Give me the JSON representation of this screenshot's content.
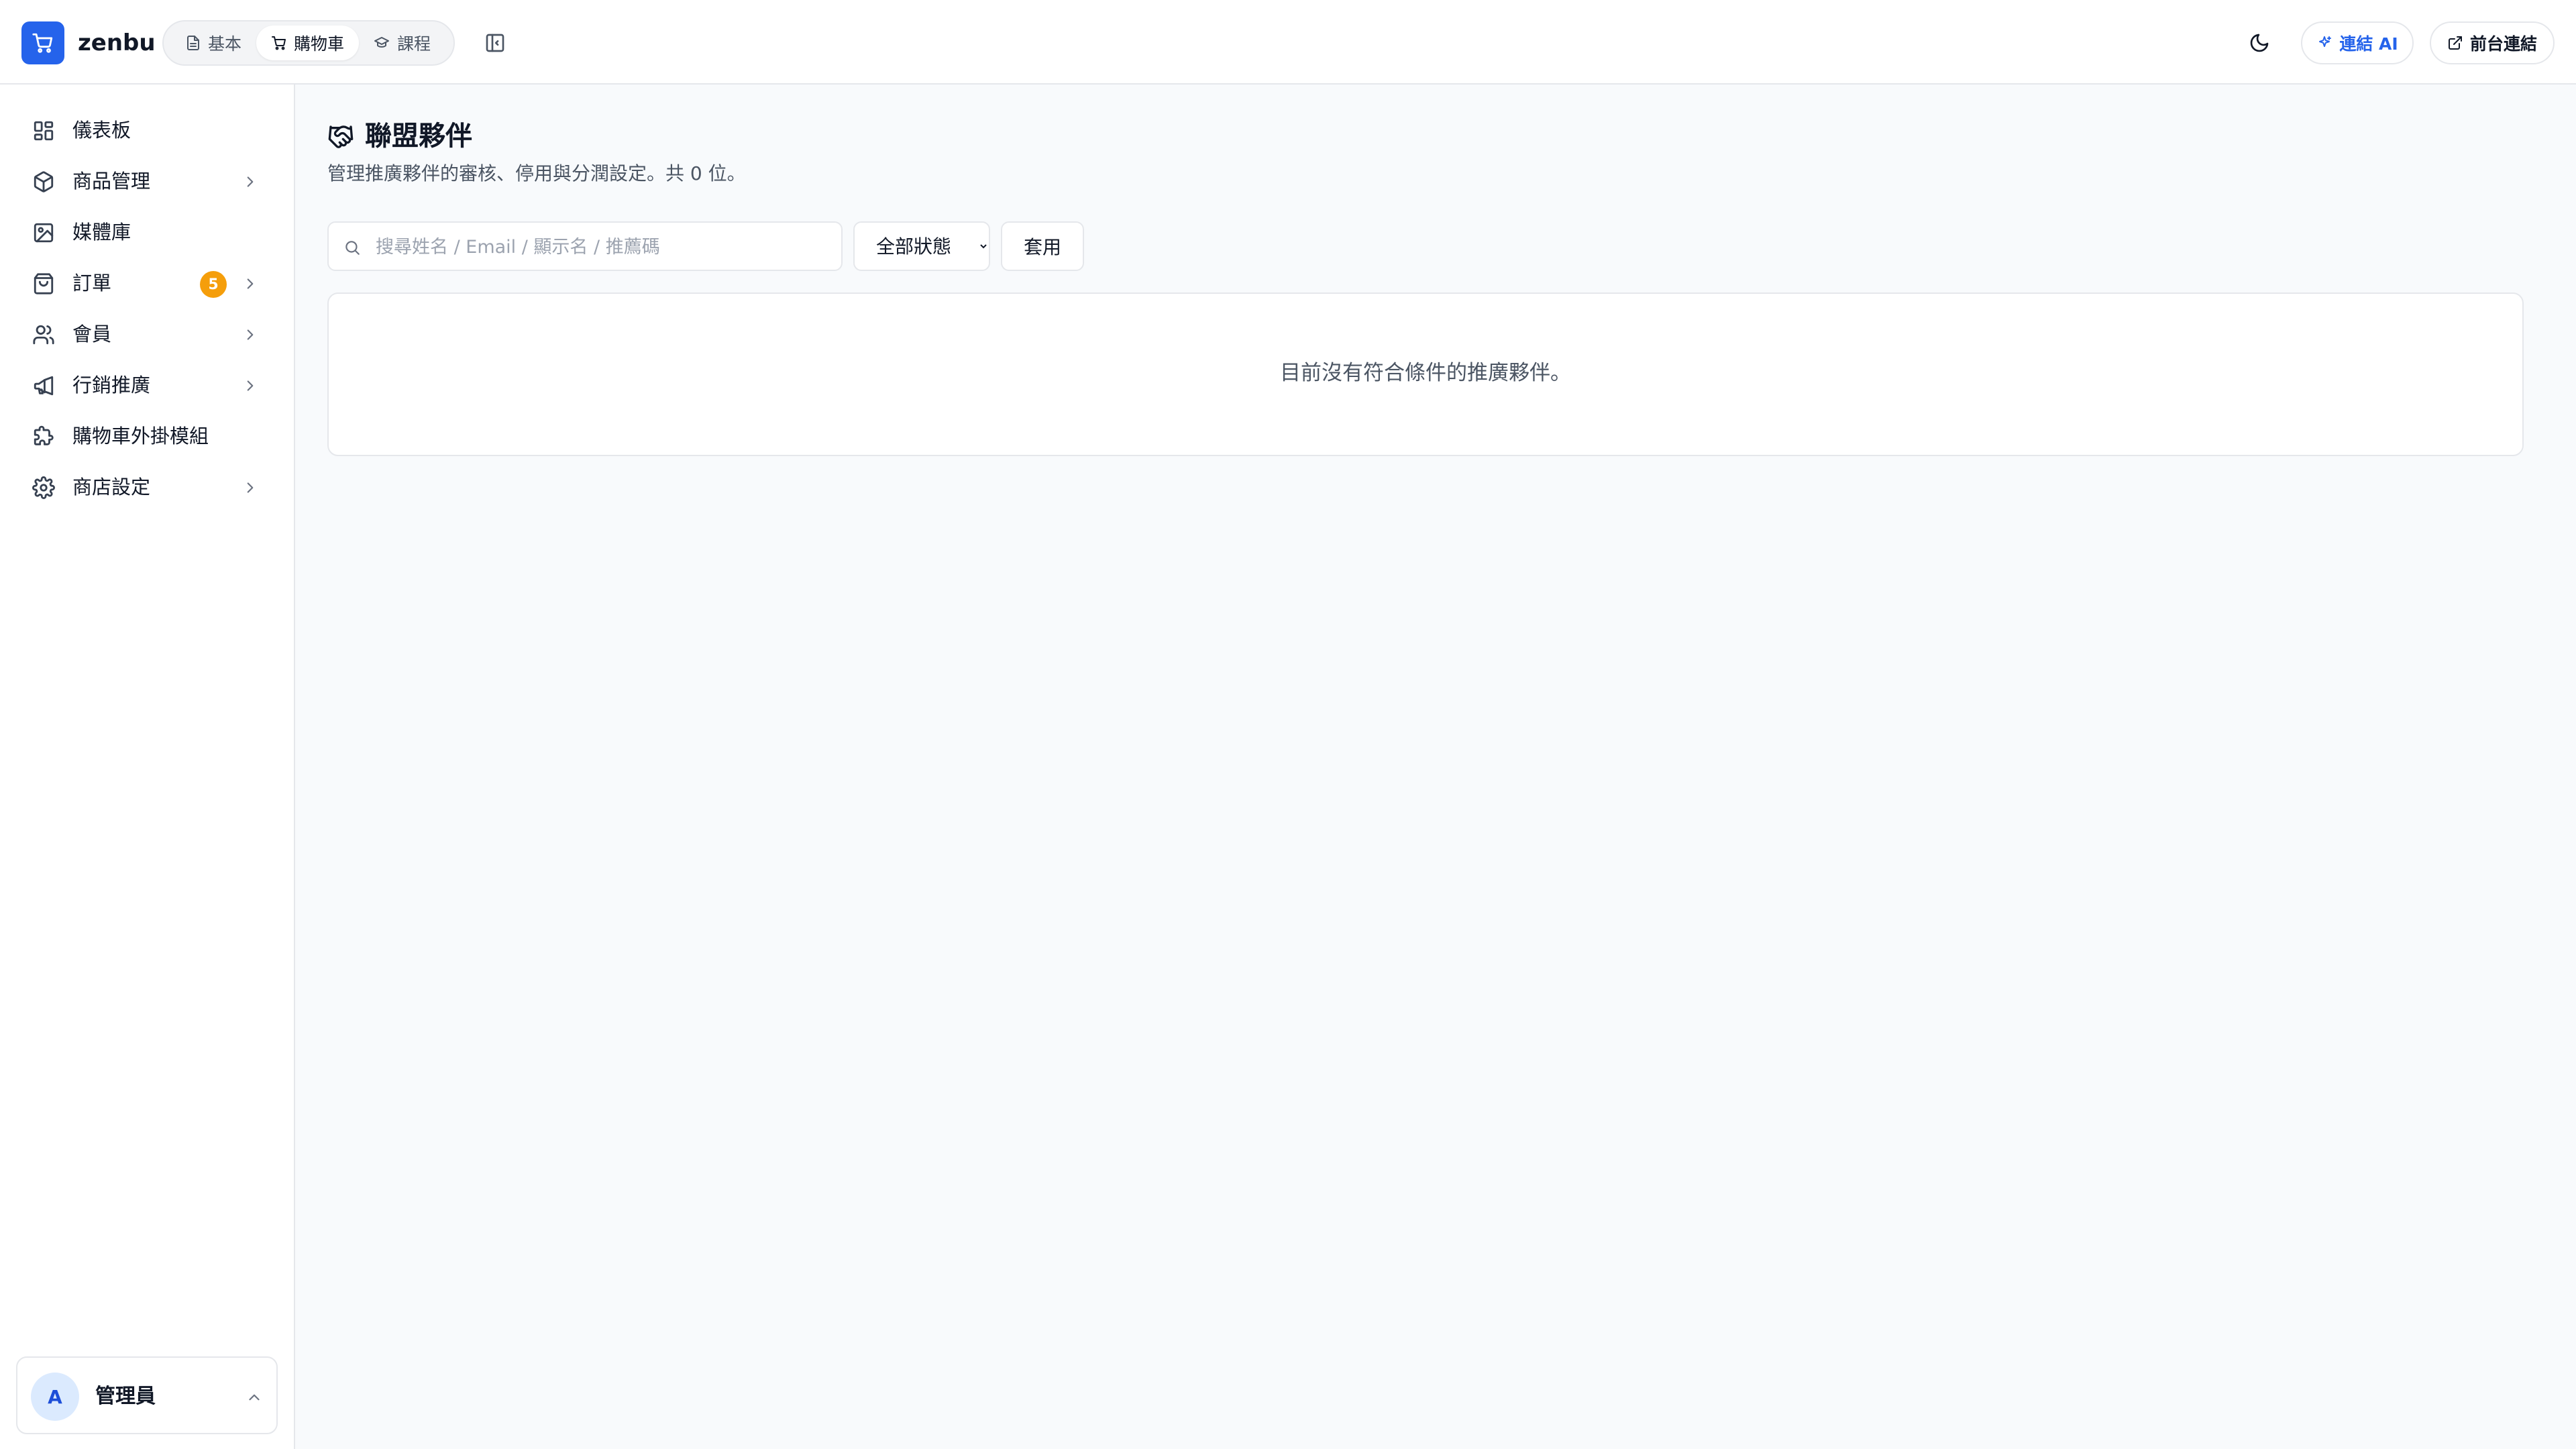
{
  "header": {
    "brand": "zenbu",
    "mode_tabs": [
      {
        "label": "基本",
        "icon": "document-icon",
        "active": false
      },
      {
        "label": "購物車",
        "icon": "cart-icon",
        "active": true
      },
      {
        "label": "課程",
        "icon": "graduation-cap-icon",
        "active": false
      }
    ],
    "connect_ai_label": "連結 AI",
    "storefront_link_label": "前台連結"
  },
  "sidebar": {
    "items": [
      {
        "label": "儀表板",
        "icon": "dashboard-icon",
        "has_submenu": false
      },
      {
        "label": "商品管理",
        "icon": "box-icon",
        "has_submenu": true
      },
      {
        "label": "媒體庫",
        "icon": "image-icon",
        "has_submenu": false
      },
      {
        "label": "訂單",
        "icon": "shopping-bag-icon",
        "has_submenu": true,
        "badge": "5"
      },
      {
        "label": "會員",
        "icon": "users-icon",
        "has_submenu": true
      },
      {
        "label": "行銷推廣",
        "icon": "megaphone-icon",
        "has_submenu": true
      },
      {
        "label": "購物車外掛模組",
        "icon": "puzzle-icon",
        "has_submenu": false
      },
      {
        "label": "商店設定",
        "icon": "gear-icon",
        "has_submenu": true
      }
    ],
    "user": {
      "avatar_initial": "A",
      "name": "管理員"
    }
  },
  "main": {
    "title": "聯盟夥伴",
    "title_icon": "handshake-icon",
    "description": "管理推廣夥伴的審核、停用與分潤設定。共 0 位。",
    "search": {
      "placeholder": "搜尋姓名 / Email / 顯示名 / 推薦碼",
      "value": ""
    },
    "status_filter": {
      "selected": "全部狀態"
    },
    "apply_label": "套用",
    "empty_message": "目前沒有符合條件的推廣夥伴。"
  },
  "colors": {
    "accent": "#2563eb",
    "badge": "#f59e0b",
    "background": "#f8fafc",
    "border": "#e5e7eb"
  }
}
